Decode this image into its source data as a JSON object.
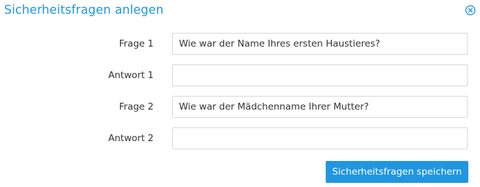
{
  "dialog": {
    "title": "Sicherheitsfragen anlegen",
    "close_icon": "close-circle-icon",
    "accent_color": "#2196e0"
  },
  "form": {
    "fields": [
      {
        "label": "Frage 1",
        "value": "Wie war der Name Ihres ersten Haustieres?",
        "placeholder": ""
      },
      {
        "label": "Antwort 1",
        "value": "",
        "placeholder": ""
      },
      {
        "label": "Frage 2",
        "value": "Wie war der Mädchenname Ihrer Mutter?",
        "placeholder": ""
      },
      {
        "label": "Antwort 2",
        "value": "",
        "placeholder": ""
      }
    ]
  },
  "actions": {
    "save_label": "Sicherheitsfragen speichern"
  }
}
